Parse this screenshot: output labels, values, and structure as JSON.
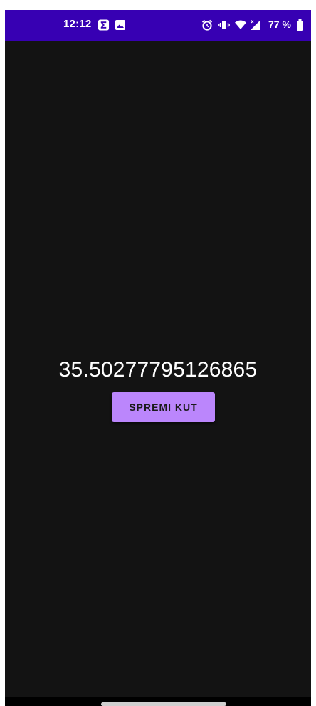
{
  "status_bar": {
    "time": "12:12",
    "battery": "77 %",
    "icons_left": [
      "sigma-icon",
      "image-icon"
    ],
    "icons_right": [
      "alarm-icon",
      "vibrate-icon",
      "wifi-icon",
      "signal-icon",
      "battery-icon"
    ],
    "background_color": "#3700b3"
  },
  "main": {
    "angle_value": "35.50277795126865",
    "save_button_label": "SPREMI KUT",
    "button_color": "#bb86fc",
    "background_color": "#131313"
  }
}
